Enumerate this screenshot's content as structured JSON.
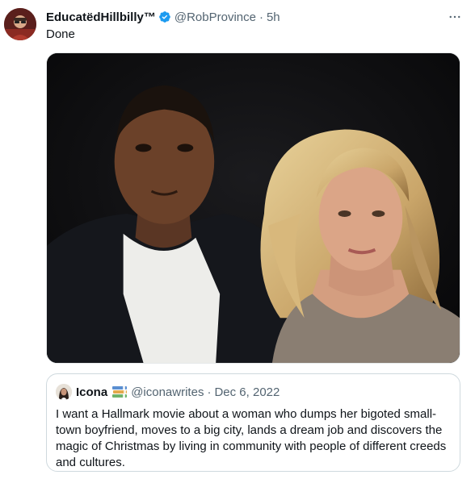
{
  "tweet": {
    "author": {
      "display_name": "EducatëdHillbilly™",
      "handle": "@RobProvince",
      "verified": true,
      "avatar_icon": "profile-photo"
    },
    "separator": "·",
    "time": "5h",
    "text": "Done",
    "more_icon": "more-horizontal-icon",
    "media": {
      "type": "photo"
    },
    "quoted": {
      "author": {
        "display_name": "Icona",
        "badge_icon": "books-emoji",
        "handle": "@iconawrites"
      },
      "separator": "·",
      "date": "Dec 6, 2022",
      "text": "I want a Hallmark movie about a woman who dumps her bigoted small-town boyfriend, moves to a big city, lands a dream job and discovers the magic of Christmas by living in community with people of different creeds and cultures."
    }
  },
  "colors": {
    "text_primary": "#0f1419",
    "text_secondary": "#536471",
    "verified_blue": "#1d9bf0",
    "border": "#cfd9de"
  }
}
